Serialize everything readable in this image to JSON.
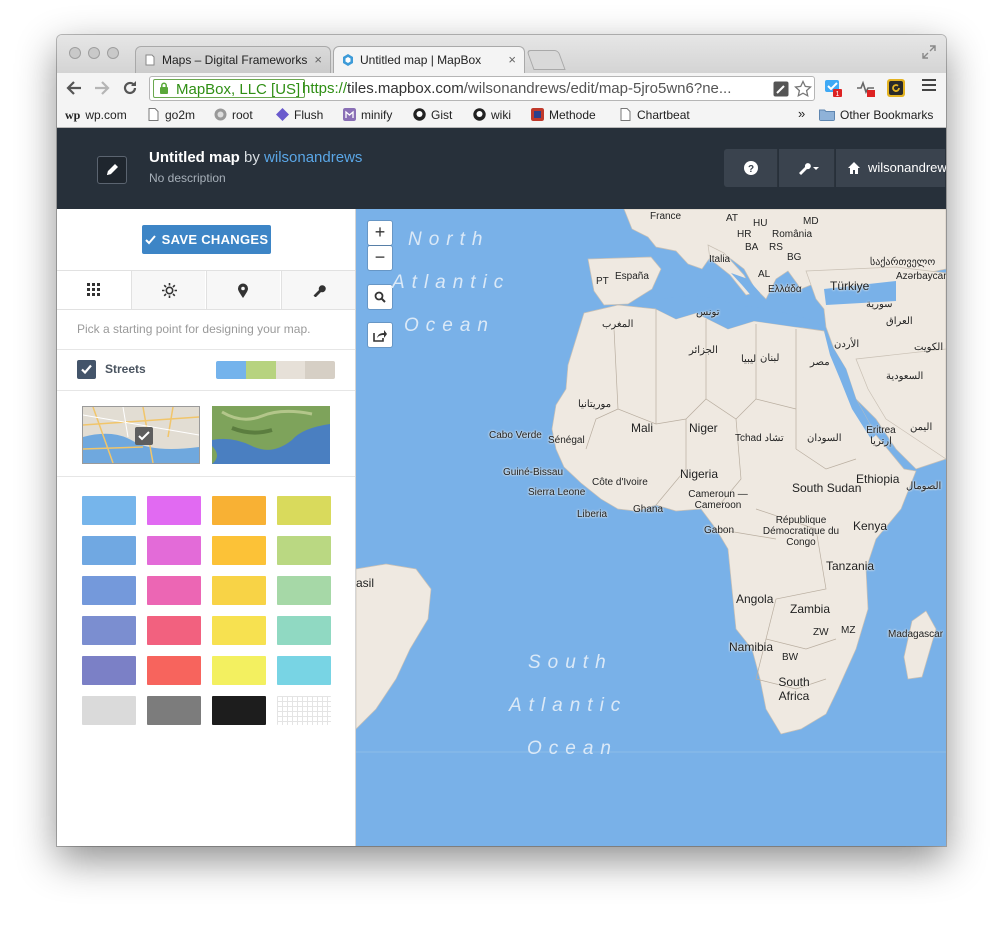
{
  "browser": {
    "tabs": [
      {
        "title": "Maps – Digital Frameworks",
        "active": false
      },
      {
        "title": "Untitled map | MapBox",
        "active": true
      }
    ],
    "tab_close": "×",
    "ev_label": "MapBox, LLC [US]",
    "url_scheme": "https://",
    "url_host": "tiles.mapbox.com",
    "url_path": "/wilsonandrews/edit/map-5jro5wn6?ne...",
    "bookmarks": [
      "wp.com",
      "go2m",
      "root",
      "Flush",
      "minify",
      "Gist",
      "wiki",
      "Methode",
      "Chartbeat"
    ],
    "bookmarks_overflow": "»",
    "other_bookmarks": "Other Bookmarks"
  },
  "header": {
    "title": "Untitled map",
    "by": "by",
    "user": "wilsonandrews",
    "description": "No description",
    "help_icon": "?",
    "account_label": "wilsonandrews"
  },
  "sidebar": {
    "save_label": "SAVE CHANGES",
    "tabs": [
      "grid-icon",
      "sun-icon",
      "marker-icon",
      "wrench-icon"
    ],
    "hint": "Pick a starting point for designing your map.",
    "style_name": "Streets",
    "style_swatches": [
      "#74b3ec",
      "#b7d37f",
      "#e6e0d8",
      "#d6cfc5"
    ],
    "palette": [
      [
        "#76b5eb",
        "#e16af2",
        "#f8b134",
        "#d9da5c"
      ],
      [
        "#70a8e2",
        "#e36bd8",
        "#fcc237",
        "#bad882"
      ],
      [
        "#7499db",
        "#ec66b4",
        "#f8d346",
        "#a6d8a7"
      ],
      [
        "#7b8ed0",
        "#f2617f",
        "#f7e150",
        "#90d9c2"
      ],
      [
        "#7b80c6",
        "#f7645d",
        "#f3f060",
        "#78d4e4"
      ],
      [
        "#dadada",
        "#7c7c7c",
        "#1d1d1d",
        "grid"
      ]
    ]
  },
  "map": {
    "zoom_in": "+",
    "zoom_out": "−",
    "oceans": [
      [
        "North",
        "Atlantic",
        "Ocean"
      ],
      [
        "South",
        "Atlantic",
        "Ocean"
      ]
    ],
    "labels": [
      "France",
      "AT",
      "HU",
      "MD",
      "HR",
      "România",
      "BA",
      "RS",
      "Italia",
      "BG",
      "PT",
      "España",
      "AL",
      "Ελλάδα",
      "Türkiye",
      "საქართველო",
      "Azərbaycan",
      "سورية",
      "العراق",
      "تونس",
      "المغرب",
      "لبنان",
      "الأردن",
      "الكويت",
      "الجزائر",
      "ليبيا",
      "مصر",
      "السعودية",
      "موريتانيا",
      "Mali",
      "Niger",
      "Tchad تشاد",
      "Cabo Verde",
      "Sénégal",
      "السودان",
      "Eritrea إرتريا",
      "اليمن",
      "Guiné-Bissau",
      "Nigeria",
      "Ethiopia",
      "Côte d'Ivoire",
      "Sierra Leone",
      "Cameroun — Cameroon",
      "South Sudan",
      "الصومال",
      "Liberia",
      "Ghana",
      "République Démocratique du Congo",
      "Kenya",
      "Gabon",
      "Tanzania",
      "asil",
      "Angola",
      "Zambia",
      "MZ",
      "ZW",
      "Madagascar",
      "Namibia",
      "BW",
      "South Africa"
    ]
  }
}
